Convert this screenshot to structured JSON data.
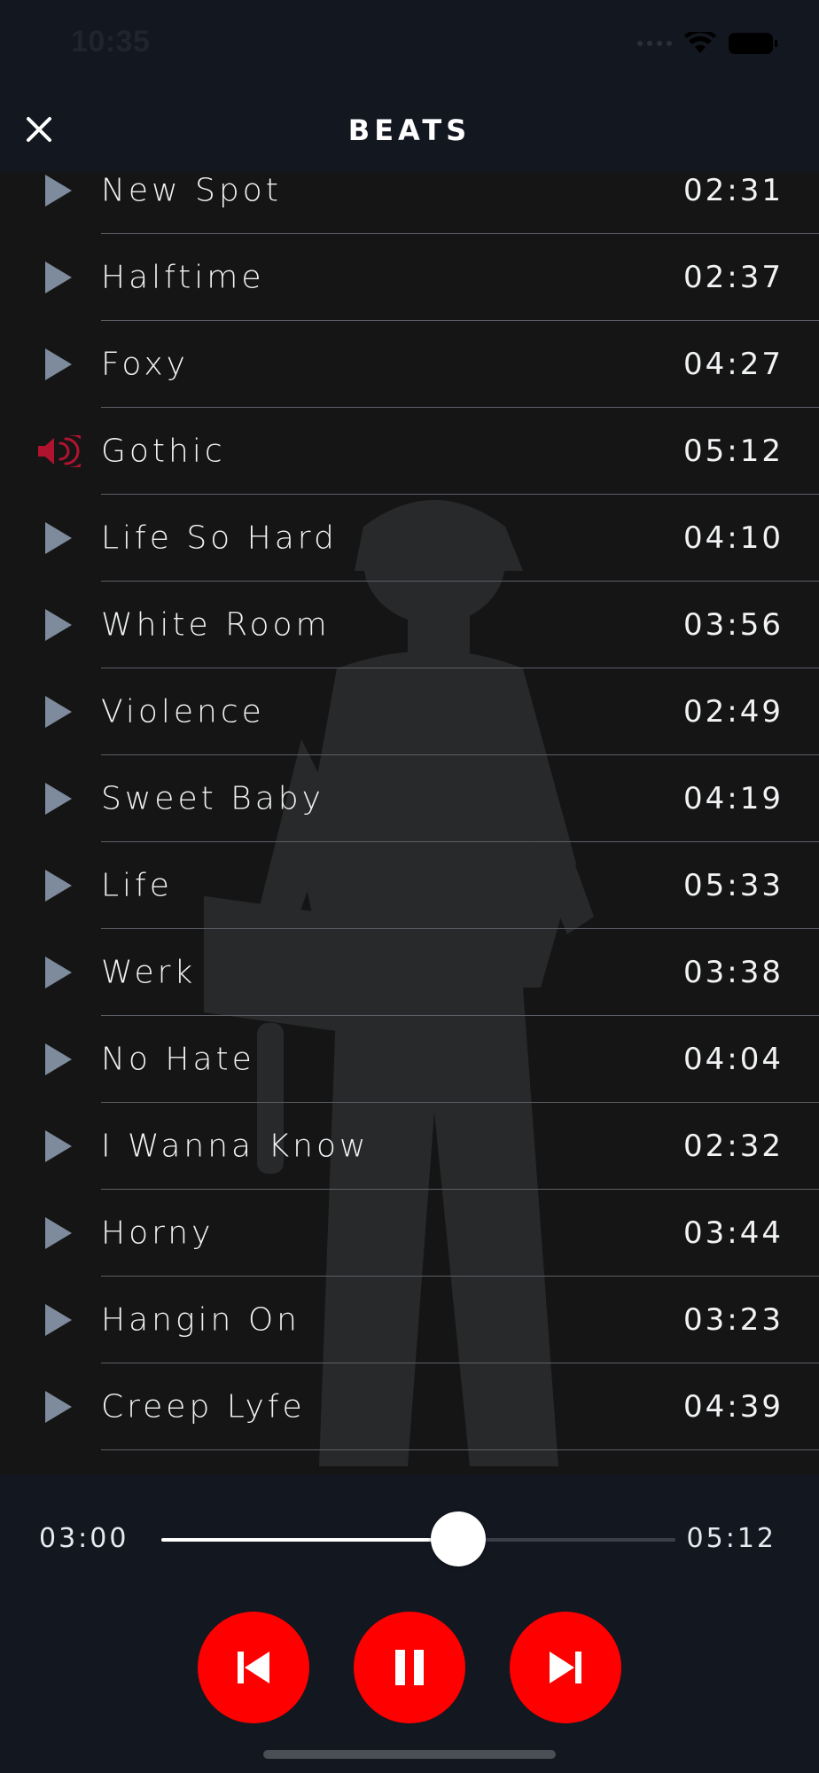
{
  "status_bar": {
    "time": "10:35"
  },
  "header": {
    "title": "BEATS"
  },
  "tracks": [
    {
      "name": "New Spot",
      "duration": "02:31",
      "state": "paused",
      "icon": "play-icon"
    },
    {
      "name": "Halftime",
      "duration": "02:37",
      "state": "paused",
      "icon": "play-icon"
    },
    {
      "name": "Foxy",
      "duration": "04:27",
      "state": "paused",
      "icon": "play-icon"
    },
    {
      "name": "Gothic",
      "duration": "05:12",
      "state": "playing",
      "icon": "speaker-icon"
    },
    {
      "name": "Life So Hard",
      "duration": "04:10",
      "state": "paused",
      "icon": "play-icon"
    },
    {
      "name": "White Room",
      "duration": "03:56",
      "state": "paused",
      "icon": "play-icon"
    },
    {
      "name": "Violence",
      "duration": "02:49",
      "state": "paused",
      "icon": "play-icon"
    },
    {
      "name": "Sweet Baby",
      "duration": "04:19",
      "state": "paused",
      "icon": "play-icon"
    },
    {
      "name": "Life",
      "duration": "05:33",
      "state": "paused",
      "icon": "play-icon"
    },
    {
      "name": "Werk",
      "duration": "03:38",
      "state": "paused",
      "icon": "play-icon"
    },
    {
      "name": "No Hate",
      "duration": "04:04",
      "state": "paused",
      "icon": "play-icon"
    },
    {
      "name": "I Wanna Know",
      "duration": "02:32",
      "state": "paused",
      "icon": "play-icon"
    },
    {
      "name": "Horny",
      "duration": "03:44",
      "state": "paused",
      "icon": "play-icon"
    },
    {
      "name": "Hangin On",
      "duration": "03:23",
      "state": "paused",
      "icon": "play-icon"
    },
    {
      "name": "Creep Lyfe",
      "duration": "04:39",
      "state": "paused",
      "icon": "play-icon"
    }
  ],
  "player": {
    "elapsed": "03:00",
    "total": "05:12",
    "progress": 0.577
  },
  "colors": {
    "accent": "#ff0000",
    "playing_icon": "#b0132e",
    "play_icon": "#7d8b9c",
    "header_bg": "#131720",
    "list_bg": "#151515"
  }
}
